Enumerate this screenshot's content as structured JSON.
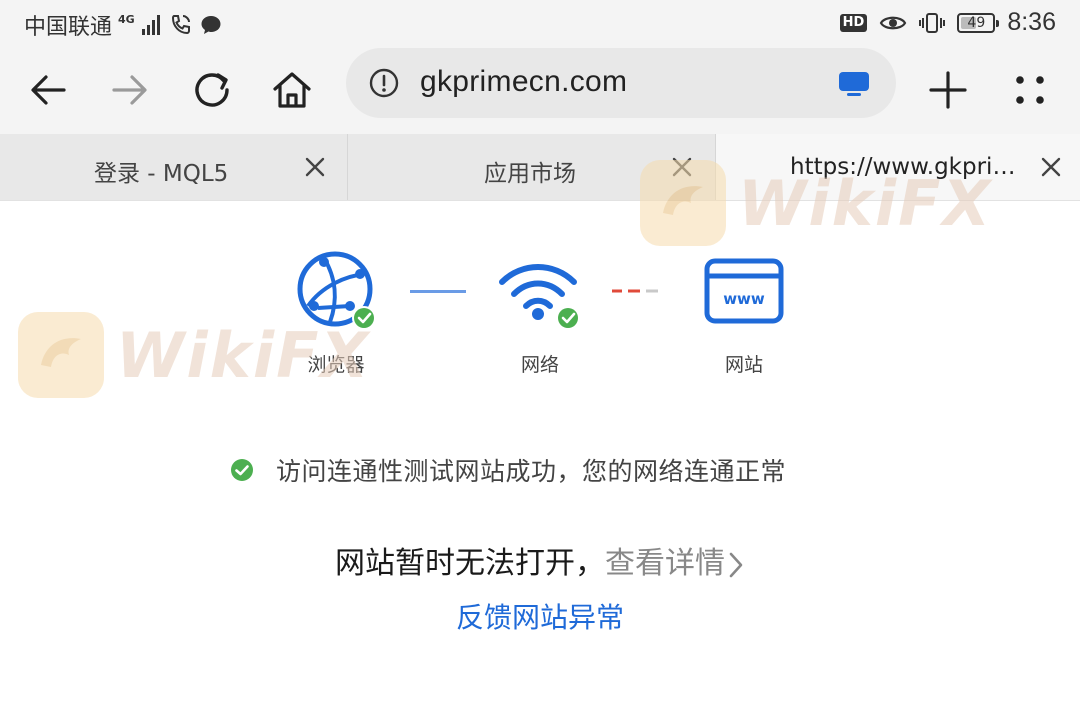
{
  "status_bar": {
    "carrier": "中国联通",
    "network": "4G",
    "battery": "49",
    "battery_level_percent": 49,
    "time": "8:36",
    "hd_badge": "HD"
  },
  "toolbar": {
    "url": "gkprimecn.com",
    "icons": [
      "back-arrow-icon",
      "forward-arrow-icon",
      "reload-icon",
      "home-icon",
      "info-icon",
      "tv-icon",
      "new-tab-plus-icon",
      "menu-dots-icon"
    ]
  },
  "tabs": [
    {
      "title": "登录 - MQL5",
      "active": false
    },
    {
      "title": "应用市场",
      "active": false
    },
    {
      "title": "https://www.gkpri…",
      "active": true
    }
  ],
  "diagram": {
    "nodes": [
      {
        "label": "浏览器",
        "status": "ok"
      },
      {
        "label": "网络",
        "status": "ok"
      },
      {
        "label": "网站",
        "status": "error",
        "icon_text": "www"
      }
    ],
    "colors": {
      "ok": "#4caf50",
      "blue": "#1f6ad8",
      "error": "#e04a3a"
    }
  },
  "message": {
    "success": "访问连通性测试网站成功，您的网络连通正常",
    "error_title": "网站暂时无法打开，",
    "details_link": "查看详情",
    "feedback_link": "反馈网站异常"
  },
  "watermark": {
    "text": "WikiFX"
  }
}
